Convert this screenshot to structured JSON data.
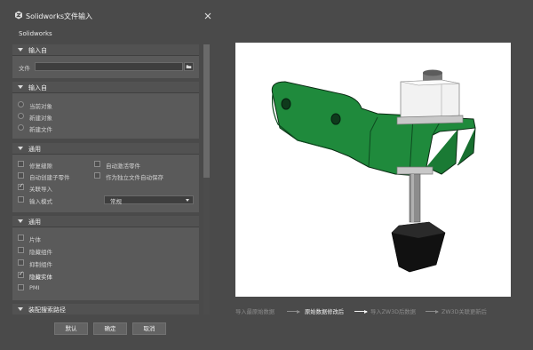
{
  "window": {
    "title": "Solidworks文件输入",
    "subtitle": "Solidworks"
  },
  "groups": {
    "input_from_1": {
      "title": "输入自",
      "file_label": "文件",
      "file_value": ""
    },
    "input_from_2": {
      "title": "输入自",
      "options": [
        "当前对象",
        "新建对象",
        "新建文件"
      ]
    },
    "general_1": {
      "title": "通用",
      "left_options": [
        {
          "label": "修复缝隙",
          "checked": false
        },
        {
          "label": "自动创建子零件",
          "checked": false
        },
        {
          "label": "关联导入",
          "checked": true
        },
        {
          "label": "输入模式",
          "checked": false
        }
      ],
      "right_options": [
        {
          "label": "自动激活零件",
          "checked": false
        },
        {
          "label": "作为独立文件自动保存",
          "checked": false
        }
      ],
      "mode_select": "常规"
    },
    "general_2": {
      "title": "通用",
      "options": [
        {
          "label": "片体",
          "checked": false
        },
        {
          "label": "隐藏组件",
          "checked": false
        },
        {
          "label": "抑制组件",
          "checked": false
        },
        {
          "label": "隐藏实体",
          "checked": true
        },
        {
          "label": "PMI",
          "checked": false
        }
      ]
    },
    "assembly_path": {
      "title": "装配搜索路径"
    }
  },
  "buttons": {
    "default": "默认",
    "ok": "确定",
    "cancel": "取消"
  },
  "steps": [
    {
      "label": "导入最原始数据",
      "active": false
    },
    {
      "label": "原始数据修改后",
      "active": true
    },
    {
      "label": "导入ZW3D后数据",
      "active": false
    },
    {
      "label": "ZW3D关联更新后",
      "active": false
    }
  ],
  "colors": {
    "background": "#4a4a4a",
    "panel": "#5a5a5a",
    "model_green": "#1f8a3c",
    "model_dark": "#111111",
    "preview_bg": "#ffffff"
  },
  "icons": [
    "solidworks-logo-icon",
    "close-icon",
    "folder-icon",
    "chevron-down-icon"
  ]
}
